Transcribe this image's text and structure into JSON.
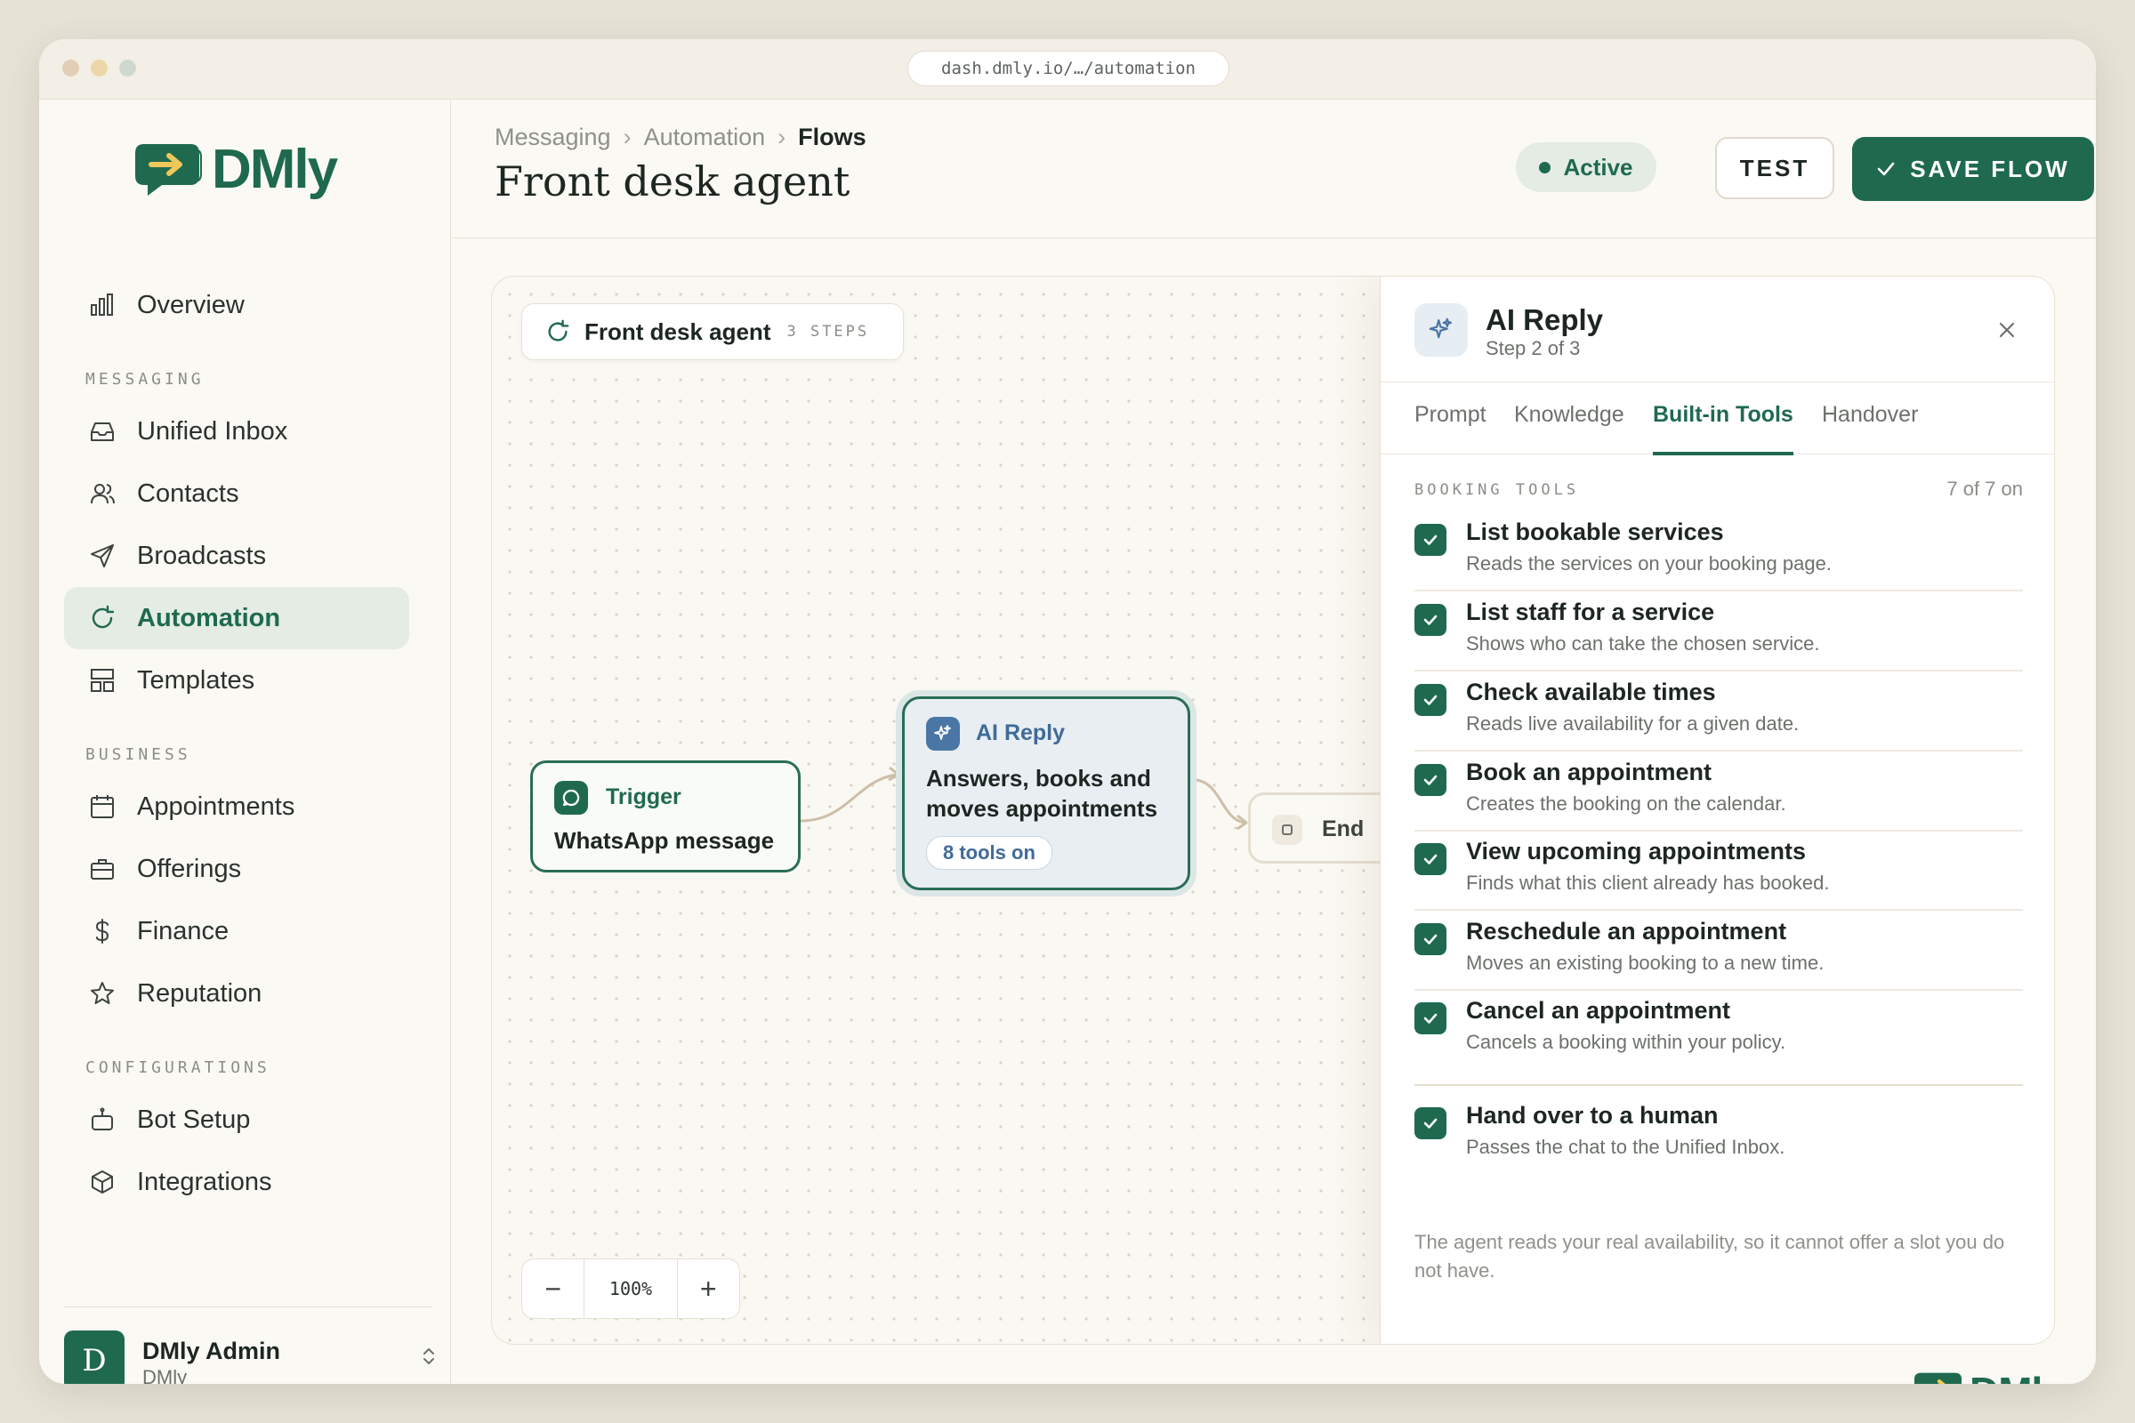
{
  "browser": {
    "url": "dash.dmly.io/…/automation"
  },
  "brand": {
    "name": "DMly",
    "color": "#1f6a4f"
  },
  "sidebar": {
    "top_item": {
      "label": "Overview",
      "icon": "bar-chart-icon"
    },
    "sections": [
      {
        "label": "MESSAGING",
        "items": [
          {
            "label": "Unified Inbox",
            "icon": "inbox-icon"
          },
          {
            "label": "Contacts",
            "icon": "users-icon"
          },
          {
            "label": "Broadcasts",
            "icon": "send-icon"
          },
          {
            "label": "Automation",
            "icon": "refresh-icon",
            "active": true
          },
          {
            "label": "Templates",
            "icon": "layout-icon"
          }
        ]
      },
      {
        "label": "BUSINESS",
        "items": [
          {
            "label": "Appointments",
            "icon": "calendar-icon"
          },
          {
            "label": "Offerings",
            "icon": "briefcase-icon"
          },
          {
            "label": "Finance",
            "icon": "dollar-icon"
          },
          {
            "label": "Reputation",
            "icon": "star-icon"
          }
        ]
      },
      {
        "label": "CONFIGURATIONS",
        "items": [
          {
            "label": "Bot Setup",
            "icon": "bot-icon"
          },
          {
            "label": "Integrations",
            "icon": "cube-icon"
          }
        ]
      }
    ],
    "user": {
      "initial": "D",
      "name": "DMly Admin",
      "org": "DMly"
    }
  },
  "header": {
    "breadcrumbs": [
      "Messaging",
      "Automation",
      "Flows"
    ],
    "separator": "›",
    "title": "Front desk agent",
    "status": "Active",
    "test_label": "TEST",
    "save_label": "SAVE FLOW"
  },
  "canvas": {
    "flow_name": "Front desk agent",
    "steps_label": "3 STEPS",
    "nodes": {
      "trigger": {
        "type": "Trigger",
        "label": "WhatsApp message"
      },
      "ai": {
        "type": "AI Reply",
        "label": "Answers, books and moves appointments",
        "badge": "8 tools on"
      },
      "end": {
        "label": "End"
      }
    },
    "zoom": {
      "minus": "−",
      "value": "100%",
      "plus": "+"
    }
  },
  "panel": {
    "title": "AI Reply",
    "subtitle": "Step 2 of 3",
    "tabs": [
      "Prompt",
      "Knowledge",
      "Built-in Tools",
      "Handover"
    ],
    "active_tab": "Built-in Tools",
    "section_label": "BOOKING TOOLS",
    "section_count": "7 of 7 on",
    "tools": [
      {
        "name": "List bookable services",
        "desc": "Reads the services on your booking page.",
        "checked": true
      },
      {
        "name": "List staff for a service",
        "desc": "Shows who can take the chosen service.",
        "checked": true
      },
      {
        "name": "Check available times",
        "desc": "Reads live availability for a given date.",
        "checked": true
      },
      {
        "name": "Book an appointment",
        "desc": "Creates the booking on the calendar.",
        "checked": true
      },
      {
        "name": "View upcoming appointments",
        "desc": "Finds what this client already has booked.",
        "checked": true
      },
      {
        "name": "Reschedule an appointment",
        "desc": "Moves an existing booking to a new time.",
        "checked": true
      },
      {
        "name": "Cancel an appointment",
        "desc": "Cancels a booking within your policy.",
        "checked": true
      }
    ],
    "handover_tool": {
      "name": "Hand over to a human",
      "desc": "Passes the chat to the Unified Inbox.",
      "checked": true
    },
    "note": "The agent reads your real availability, so it cannot offer a slot you do not have."
  },
  "colors": {
    "accent": "#1f6a4f",
    "ai_blue": "#4a76a5",
    "background": "#fbf9f4"
  }
}
